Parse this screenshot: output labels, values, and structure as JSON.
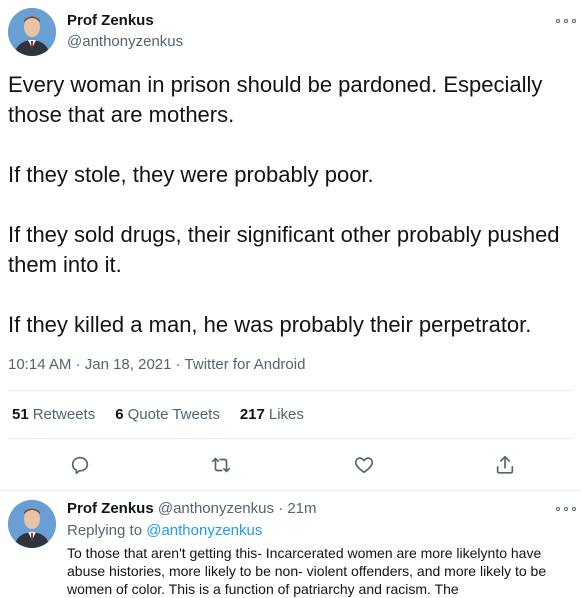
{
  "tweet": {
    "author": {
      "name": "Prof Zenkus",
      "handle": "@anthonyzenkus"
    },
    "paragraphs": [
      "Every woman in prison should be pardoned. Especially those that are mothers.",
      "If they stole, they were probably poor.",
      "If they sold drugs, their significant other probably pushed them into it.",
      "If they killed a man, he was probably their perpetrator."
    ],
    "time": "10:14 AM",
    "separator": " · ",
    "date": "Jan 18, 2021",
    "source": "Twitter for Android",
    "stats": {
      "retweets_count": "51",
      "retweets_label": "Retweets",
      "quotes_count": "6",
      "quotes_label": "Quote Tweets",
      "likes_count": "217",
      "likes_label": "Likes"
    },
    "actions": [
      "reply-icon",
      "retweet-icon",
      "like-icon",
      "share-icon"
    ]
  },
  "reply": {
    "author": {
      "name": "Prof Zenkus",
      "handle": "@anthonyzenkus",
      "separator": " · ",
      "time_ago": "21m"
    },
    "replying_prefix": "Replying to ",
    "replying_to": "@anthonyzenkus",
    "text": "To those that aren't getting this- Incarcerated women are more likelynto have abuse histories, more likely to be non- violent offenders, and more likely to be women of color. This is a function of patriarchy and racism. The"
  },
  "colors": {
    "accent": "#1d9bf0",
    "secondary_text": "#536471",
    "primary_text": "#0f1419"
  }
}
